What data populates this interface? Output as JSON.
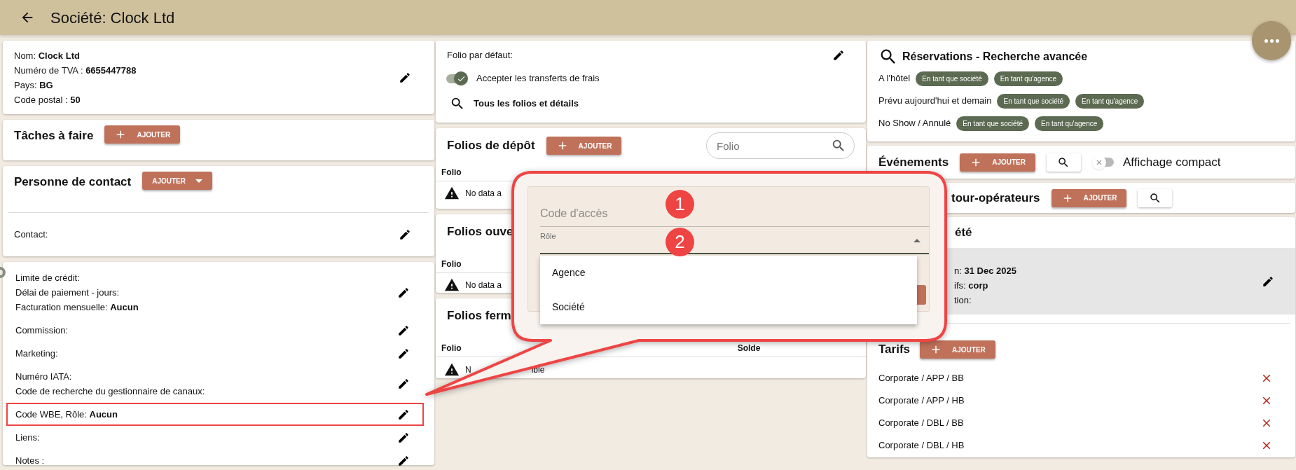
{
  "header": {
    "title": "Société: Clock Ltd"
  },
  "company_card": {
    "fields": [
      "Nom: **Clock Ltd**",
      "Numéro de TVA : **6655447788**",
      "Pays: **BG**",
      "Code postal : **50**"
    ]
  },
  "tasks": {
    "title": "Tâches à faire",
    "add_button": "AJOUTER"
  },
  "contact_person": {
    "title": "Personne de contact",
    "add_button": "AJOUTER",
    "contact_label": "Contact:"
  },
  "billing": {
    "groups": [
      {
        "lines": [
          "Limite de crédit:",
          "Délai de paiement - jours:",
          "Facturation mensuelle: **Aucun**"
        ],
        "highlighted": false
      },
      {
        "lines": [
          "Commission:"
        ],
        "highlighted": false
      },
      {
        "lines": [
          "Marketing:"
        ],
        "highlighted": false
      },
      {
        "lines": [
          "Numéro IATA:",
          "Code de recherche du gestionnaire de canaux:"
        ],
        "highlighted": false
      },
      {
        "lines": [
          "Code WBE, Rôle: **Aucun**"
        ],
        "highlighted": true
      },
      {
        "lines": [
          "Liens:"
        ],
        "highlighted": false
      },
      {
        "lines": [
          "Notes :"
        ],
        "highlighted": false
      }
    ]
  },
  "folio_settings": {
    "default_folio_label": "Folio par défaut:",
    "accept_transfers": {
      "label": "Accepter les transferts de frais",
      "on": true
    },
    "all_folios_link": "Tous les folios et détails"
  },
  "folio_tables": [
    {
      "title": "Folios de dépôt",
      "add_button": "AJOUTER",
      "search_placeholder": "Folio",
      "columns": [
        "Folio"
      ],
      "empty_text": [
        "No data a"
      ]
    },
    {
      "title": "Folios ouve",
      "columns": [
        "Folio"
      ],
      "empty_text": [
        "No data a"
      ]
    },
    {
      "title": "Folios ferm",
      "columns": [
        "Folio",
        "Solde"
      ],
      "empty_text": [
        "N",
        "ible"
      ]
    }
  ],
  "reservations": {
    "title": "Réservations - Recherche avancée",
    "rows": [
      {
        "label": "A l'hôtel",
        "chips": [
          "En tant que société",
          "En tant qu'agence"
        ]
      },
      {
        "label": "Prévu aujourd'hui et demain",
        "chips": [
          "En tant que société",
          "En tant qu'agence"
        ]
      },
      {
        "label": "No Show / Annulé",
        "chips": [
          "En tant que société",
          "En tant qu'agence"
        ]
      }
    ]
  },
  "events": {
    "title": "Événements",
    "add_button": "AJOUTER",
    "compact_view": {
      "label": "Affichage compact",
      "on": false
    }
  },
  "tour_operators": {
    "title": "tour-opérateurs",
    "add_button": "AJOUTER"
  },
  "company_contract": {
    "title": "été",
    "lines": [
      "n: **31 Dec 2025**",
      "ifs: **corp**",
      "tion:"
    ],
    "tariffs_title": "Tarifs",
    "add_button": "AJOUTER",
    "tariffs": [
      "Corporate / APP / BB",
      "Corporate / APP / HB",
      "Corporate / DBL / BB",
      "Corporate / DBL / HB"
    ]
  },
  "callout": {
    "badges": [
      "1",
      "2"
    ],
    "access_code_placeholder": "Code d'accès",
    "role_label": "Rôle",
    "role_expanded": true,
    "role_options": [
      "Agence",
      "Société"
    ]
  }
}
